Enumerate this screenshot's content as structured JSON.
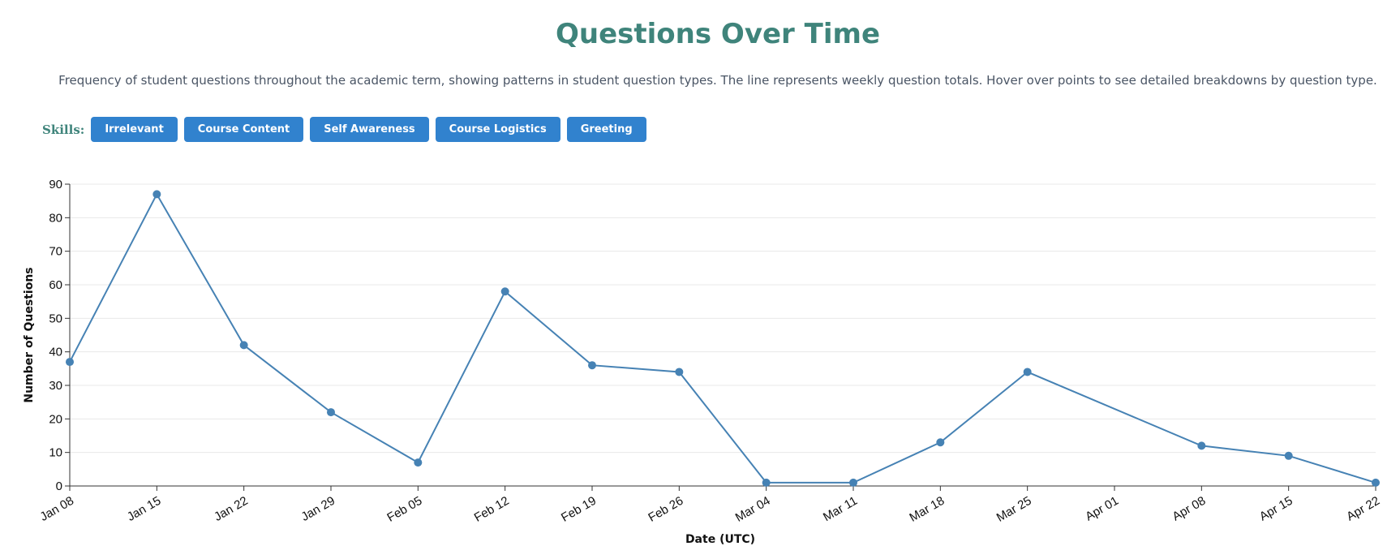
{
  "header": {
    "title": "Questions Over Time",
    "subtitle": "Frequency of student questions throughout the academic term, showing patterns in student question types. The line represents weekly question totals. Hover over points to see detailed breakdowns by question type."
  },
  "skills": {
    "label": "Skills:",
    "buttons": [
      "Irrelevant",
      "Course Content",
      "Self Awareness",
      "Course Logistics",
      "Greeting"
    ]
  },
  "colors": {
    "title": "#3f847b",
    "button": "#3182ce",
    "line": "#4682b4",
    "grid": "#e8e8e8"
  },
  "chart_data": {
    "type": "line",
    "title": "",
    "xlabel": "Date (UTC)",
    "ylabel": "Number of Questions",
    "ylim": [
      0,
      90
    ],
    "y_ticks": [
      0,
      10,
      20,
      30,
      40,
      50,
      60,
      70,
      80,
      90
    ],
    "x_ticks": [
      "Jan 08",
      "Jan 15",
      "Jan 22",
      "Jan 29",
      "Feb 05",
      "Feb 12",
      "Feb 19",
      "Feb 26",
      "Mar 04",
      "Mar 11",
      "Mar 18",
      "Mar 25",
      "Apr 01",
      "Apr 08",
      "Apr 15",
      "Apr 22"
    ],
    "grid": "horizontal",
    "series": [
      {
        "x": [
          "Jan 08",
          "Jan 15",
          "Jan 22",
          "Jan 29",
          "Feb 05",
          "Feb 12",
          "Feb 19",
          "Feb 26",
          "Mar 04",
          "Mar 11",
          "Mar 18",
          "Mar 25",
          "Apr 08",
          "Apr 15",
          "Apr 22"
        ],
        "values": [
          37,
          87,
          42,
          22,
          7,
          58,
          36,
          34,
          1,
          1,
          13,
          34,
          12,
          9,
          1
        ]
      }
    ]
  }
}
